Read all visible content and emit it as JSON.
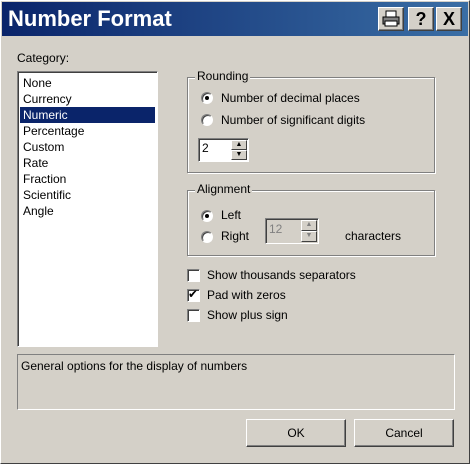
{
  "window": {
    "title": "Number Format",
    "title_buttons": [
      {
        "name": "printer-icon",
        "glyph": "🖶"
      },
      {
        "name": "help-icon",
        "glyph": "?"
      },
      {
        "name": "close-icon",
        "glyph": "X"
      }
    ]
  },
  "category": {
    "label": "Category:",
    "items": [
      "None",
      "Currency",
      "Numeric",
      "Percentage",
      "Custom",
      "Rate",
      "Fraction",
      "Scientific",
      "Angle"
    ],
    "selected": "Numeric"
  },
  "rounding": {
    "title": "Rounding",
    "option_decimal": "Number of decimal places",
    "option_significant": "Number of significant digits",
    "value": "2",
    "selected": "decimal"
  },
  "alignment": {
    "title": "Alignment",
    "option_left": "Left",
    "option_right": "Right",
    "width_value": "12",
    "characters_label": "characters",
    "selected": "left"
  },
  "options": {
    "thousands": {
      "label": "Show thousands separators",
      "checked": false
    },
    "pad_zeros": {
      "label": "Pad with zeros",
      "checked": true
    },
    "plus_sign": {
      "label": "Show plus sign",
      "checked": false
    }
  },
  "description": "General options for the display of numbers",
  "buttons": {
    "ok": "OK",
    "cancel": "Cancel"
  },
  "colors": {
    "titlebar": "#0a246a",
    "selection": "#0a246a",
    "face": "#d4d0c8"
  }
}
